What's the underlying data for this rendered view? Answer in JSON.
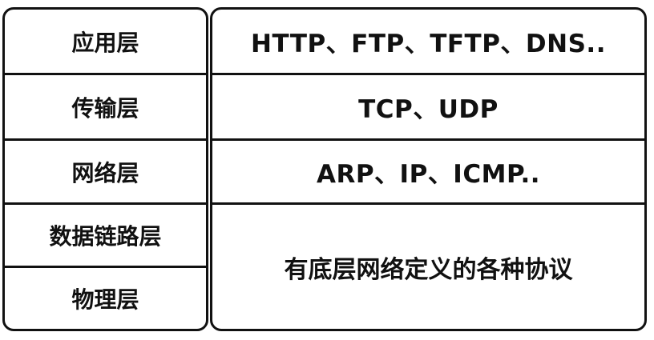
{
  "layers": [
    {
      "name": "应用层",
      "protocols": "HTTP、FTP、TFTP、DNS.."
    },
    {
      "name": "传输层",
      "protocols": "TCP、UDP"
    },
    {
      "name": "网络层",
      "protocols": "ARP、IP、ICMP.."
    },
    {
      "name": "数据链路层"
    },
    {
      "name": "物理层"
    }
  ],
  "bottom_protocols": "有底层网络定义的各种协议"
}
